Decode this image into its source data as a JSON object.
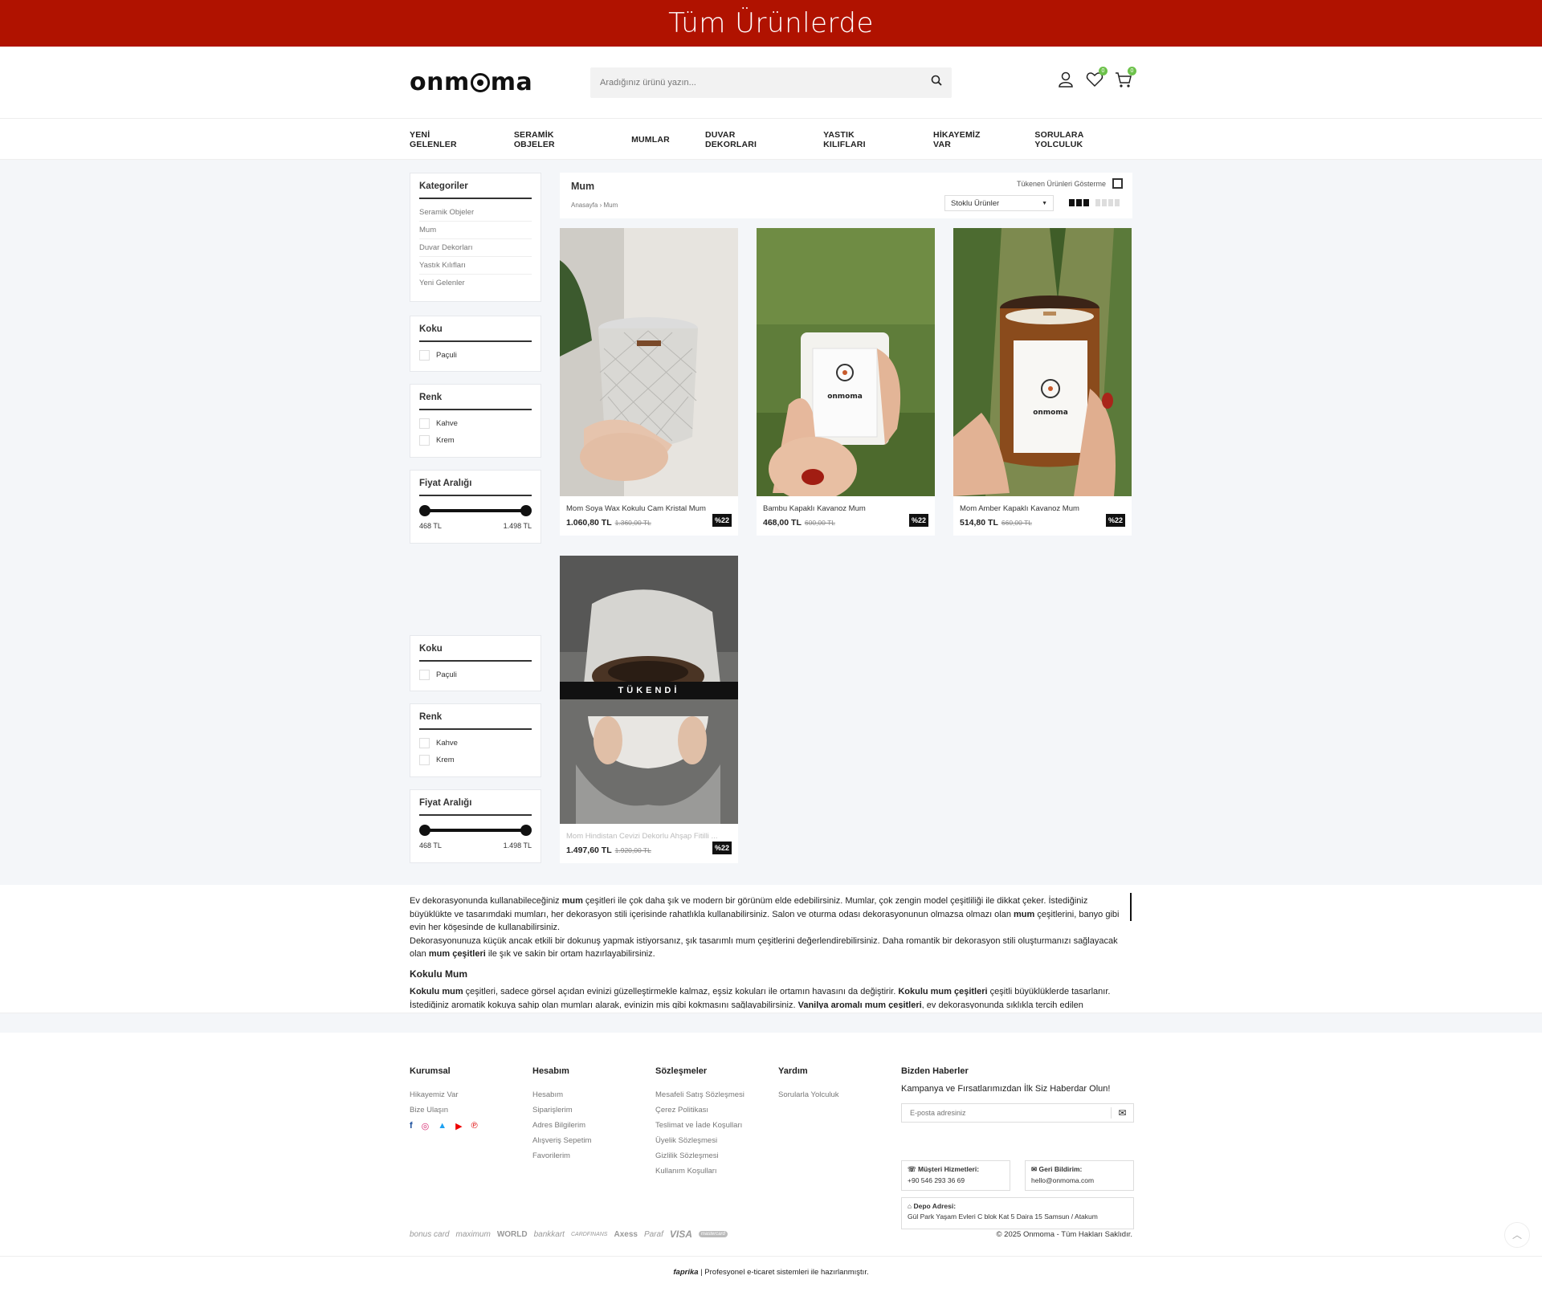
{
  "topbar": {
    "text": "Tüm Ürünlerde"
  },
  "header": {
    "logo_text": "onmoma",
    "search_placeholder": "Aradığınız ürünü yazın...",
    "wishlist_count": "0",
    "cart_count": "0"
  },
  "nav": [
    "YENİ GELENLER",
    "SERAMİK OBJELER",
    "MUMLAR",
    "DUVAR DEKORLARI",
    "YASTIK KILIFLARI",
    "HİKAYEMİZ VAR",
    "SORULARA YOLCULUK"
  ],
  "sidebar": {
    "categories_title": "Kategoriler",
    "categories": [
      "Seramik Objeler",
      "Mum",
      "Duvar Dekorları",
      "Yastık Kılıfları",
      "Yeni Gelenler"
    ],
    "scent_title": "Koku",
    "scents": [
      "Paçuli"
    ],
    "color_title": "Renk",
    "colors": [
      "Kahve",
      "Krem"
    ],
    "price_title": "Fiyat Aralığı",
    "price_min": "468 TL",
    "price_max": "1.498 TL"
  },
  "listing": {
    "title": "Mum",
    "breadcrumb_home": "Anasayfa",
    "breadcrumb_current": "Mum",
    "hide_sold_out_label": "Tükenen Ürünleri Gösterme",
    "sort_value": "Stoklu Ürünler"
  },
  "products": [
    {
      "name": "Mom Soya Wax Kokulu Cam Kristal Mum",
      "price": "1.060,80 TL",
      "old_price": "1.360,00 TL",
      "discount": "%22"
    },
    {
      "name": "Bambu Kapaklı Kavanoz Mum",
      "price": "468,00 TL",
      "old_price": "600,00 TL",
      "discount": "%22"
    },
    {
      "name": "Mom Amber Kapaklı Kavanoz Mum",
      "price": "514,80 TL",
      "old_price": "660,00 TL",
      "discount": "%22"
    },
    {
      "name": "Mom Hindistan Cevizi Dekorlu Ahşap Fitilli ...",
      "price": "1.497,60 TL",
      "old_price": "1.920,00 TL",
      "discount": "%22",
      "sold_out": "TÜKENDİ"
    }
  ],
  "seo": {
    "p1a": "Ev dekorasyonunda kullanabileceğiniz ",
    "p1b": "mum",
    "p1c": " çeşitleri ile çok daha şık ve modern bir görünüm elde edebilirsiniz. Mumlar, çok zengin model çeşitliliği ile dikkat çeker. İstediğiniz büyüklükte ve tasarımdaki mumları, her dekorasyon stili içerisinde rahatlıkla kullanabilirsiniz. Salon ve oturma odası dekorasyonunun olmazsa olmazı olan ",
    "p1d": "mum",
    "p1e": " çeşitlerini, banyo gibi evin her köşesinde de kullanabilirsiniz.",
    "p2a": "Dekorasyonunuza küçük ancak etkili bir dokunuş yapmak istiyorsanız, şık tasarımlı mum çeşitlerini değerlendirebilirsiniz. Daha romantik bir dekorasyon stili oluşturmanızı sağlayacak olan ",
    "p2b": "mum çeşitleri",
    "p2c": " ile şık ve sakin bir ortam hazırlayabilirsiniz.",
    "h3": "Kokulu Mum",
    "p3a": "Kokulu mum",
    "p3b": " çeşitleri, sadece görsel açıdan evinizi güzelleştirmekle kalmaz, eşsiz kokuları ile ortamın havasını da değiştirir. ",
    "p3c": "Kokulu mum çeşitleri",
    "p3d": " çeşitli büyüklüklerde tasarlanır. İstediğiniz aromatik kokuya sahip olan mumları alarak, evinizin mis gibi kokmasını sağlayabilirsiniz. ",
    "p3e": "Vanilya aromalı mum çeşitleri",
    "p3f": ", ev dekorasyonunda sıklıkla tercih edilen ürünlerdir."
  },
  "footer": {
    "kurumsal_title": "Kurumsal",
    "kurumsal": [
      "Hikayemiz Var",
      "Bize Ulaşın"
    ],
    "hesabim_title": "Hesabım",
    "hesabim": [
      "Hesabım",
      "Siparişlerim",
      "Adres Bilgilerim",
      "Alışveriş Sepetim",
      "Favorilerim"
    ],
    "sozlesmeler_title": "Sözleşmeler",
    "sozlesmeler": [
      "Mesafeli Satış Sözleşmesi",
      "Çerez Politikası",
      "Teslimat ve İade Koşulları",
      "Üyelik Sözleşmesi",
      "Gizlilik Sözleşmesi",
      "Kullanım Koşulları"
    ],
    "yardim_title": "Yardım",
    "yardim": [
      "Sorularla Yolculuk"
    ],
    "newsletter_title": "Bizden Haberler",
    "newsletter_text": "Kampanya ve Fırsatlarımızdan İlk Siz Haberdar Olun!",
    "email_placeholder": "E-posta adresiniz",
    "support_label": "Müşteri Hizmetleri:",
    "support_phone": "+90 546 293 36 69",
    "feedback_label": "Geri Bildirim:",
    "feedback_email": "hello@onmoma.com",
    "depot_label": "Depo Adresi:",
    "depot_address": "Gül Park Yaşam Evleri C blok Kat 5 Daira 15 Samsun / Atakum",
    "payments": [
      "bonus card",
      "maximum",
      "WORLD",
      "bankkart",
      "CARDFINANS",
      "Axess",
      "Paraf",
      "VISA",
      "mastercard"
    ],
    "copyright": "© 2025 Onmoma - Tüm Hakları Saklıdır.",
    "credit_brand": "faprika",
    "credit_text": "| Profesyonel e-ticaret sistemleri ile hazırlanmıştır."
  }
}
